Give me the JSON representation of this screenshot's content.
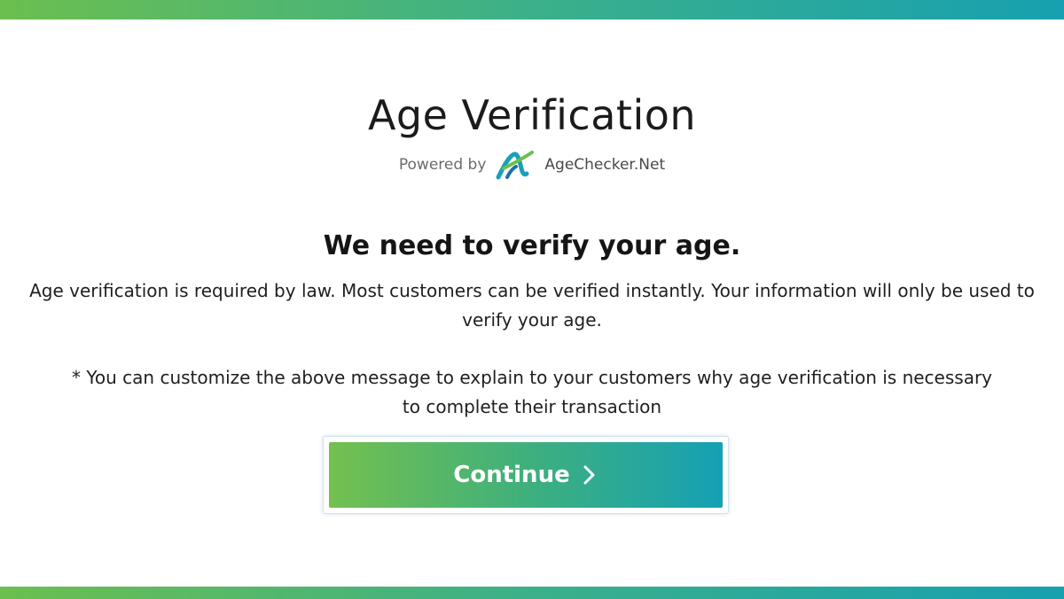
{
  "header": {
    "title": "Age Verification",
    "powered_by": "Powered by",
    "brand_name": "AgeChecker.Net",
    "logo_icon": "agechecker-logo-icon"
  },
  "main": {
    "heading": "We need to verify your age.",
    "message": "Age verification is required by law. Most customers can be verified instantly. Your information will only be used to verify your age.",
    "note": "* You can customize the above message to explain to your customers why age verification is necessary to complete their transaction"
  },
  "button": {
    "label": "Continue",
    "icon": "chevron-right-icon"
  },
  "colors": {
    "gradient_start": "#74c04f",
    "gradient_end": "#16a0b5",
    "background": "#ffffff"
  }
}
